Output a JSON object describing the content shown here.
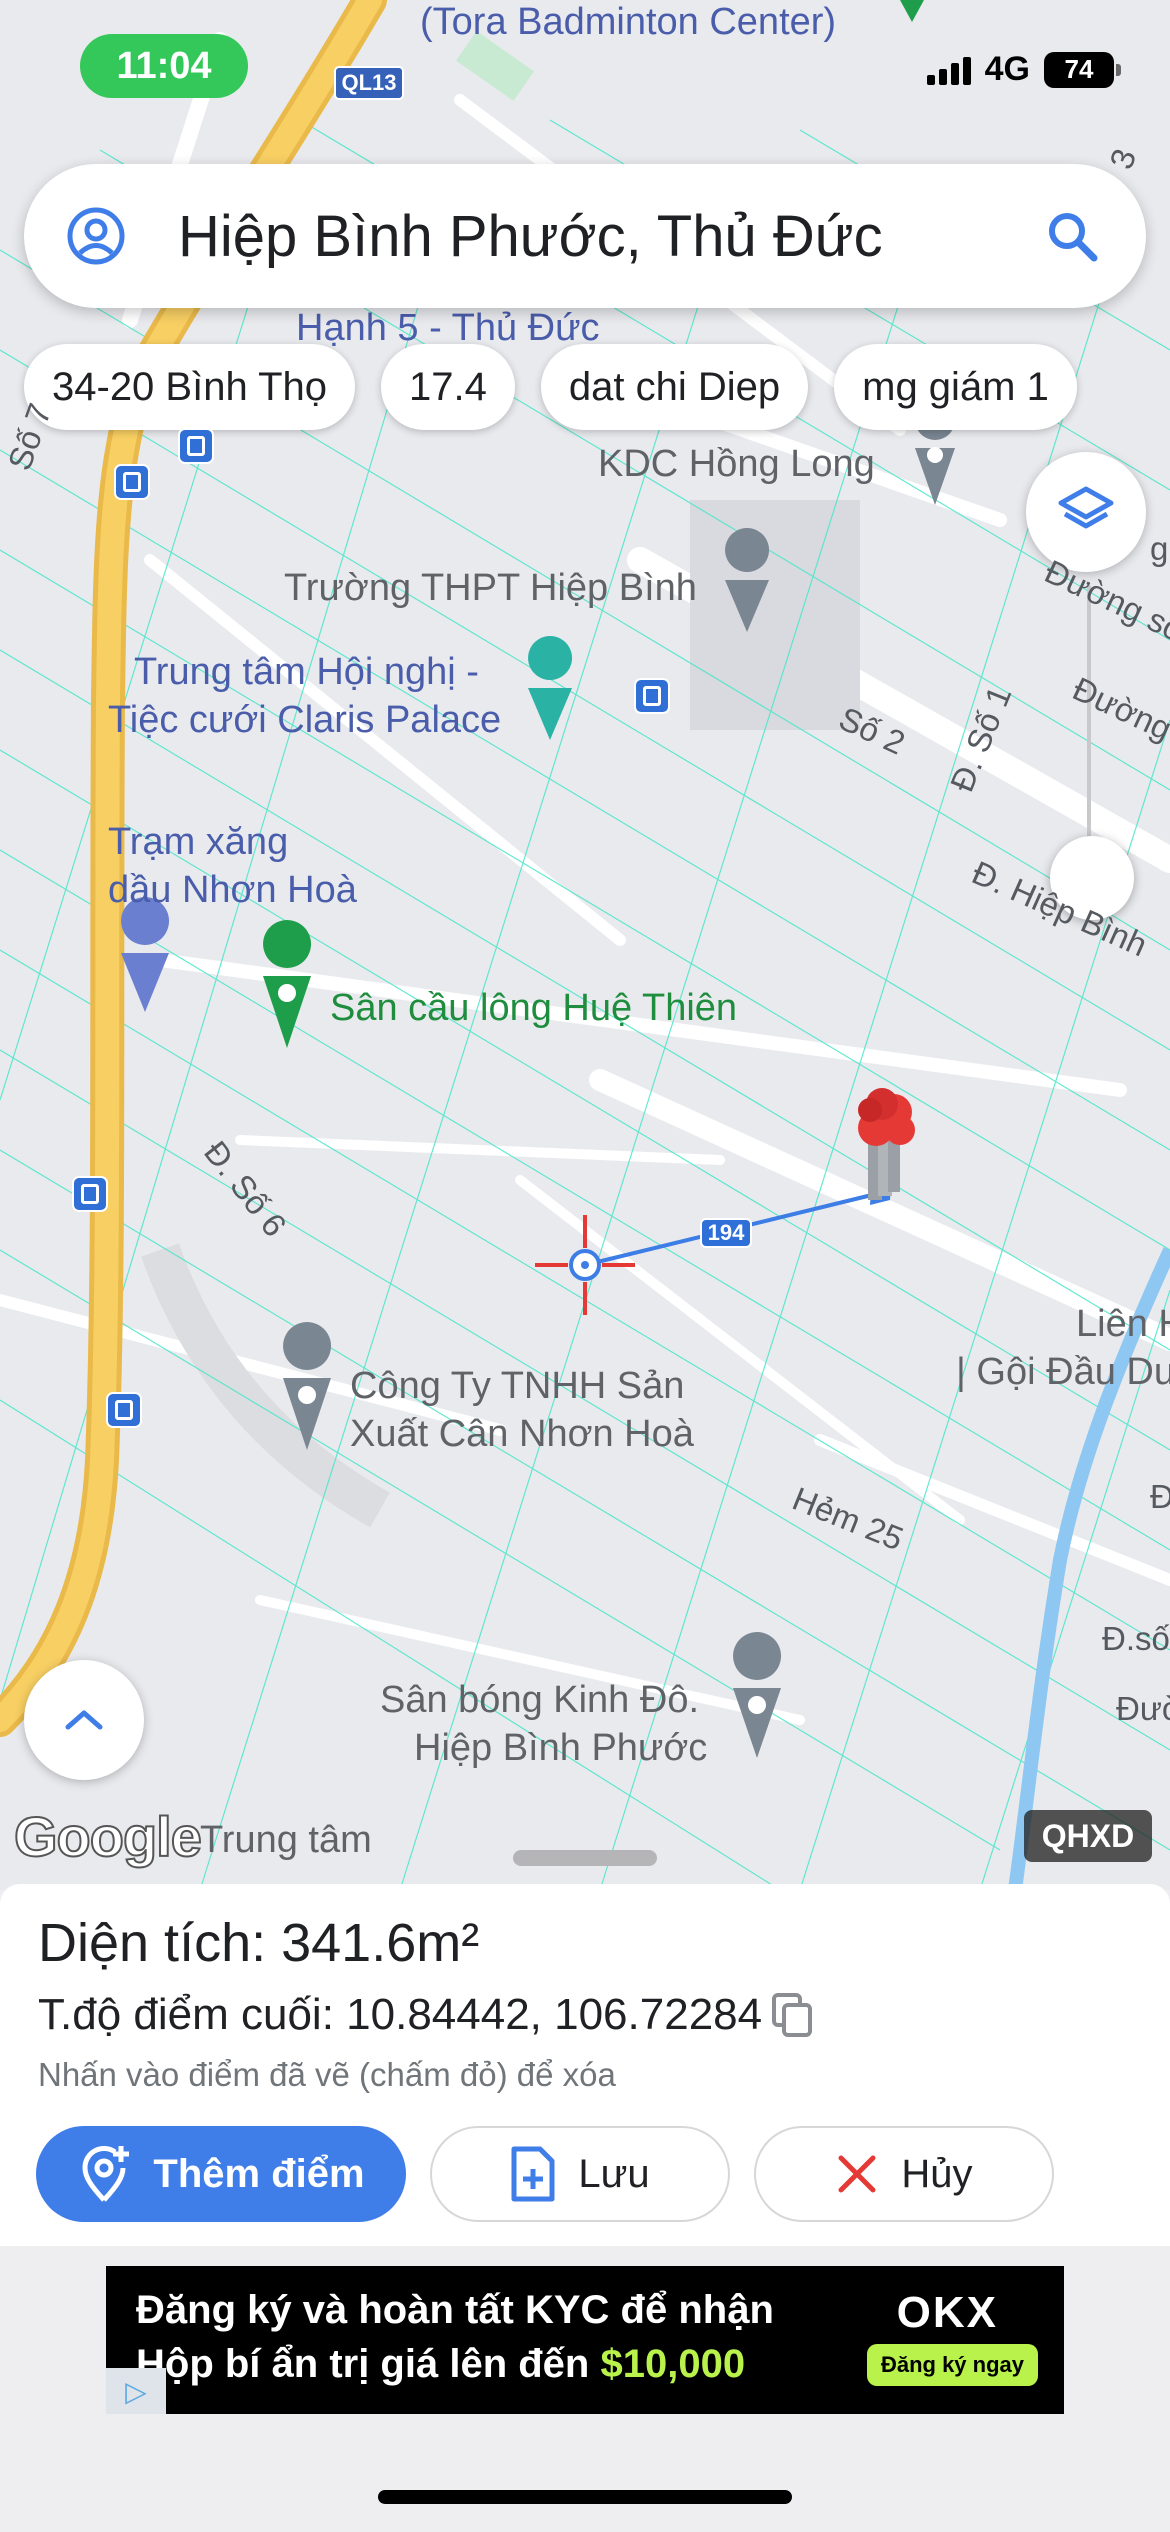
{
  "status_bar": {
    "time": "11:04",
    "network": "4G",
    "battery": "74"
  },
  "search": {
    "query": "Hiệp Bình Phước, Thủ Đức"
  },
  "chips": [
    "34-20 Bình Thọ",
    "17.4",
    "dat chi Diep",
    "mg giám 1"
  ],
  "map": {
    "places": {
      "top_center": "(Tora Badminton Center)",
      "top_partial": "Hạnh 5 - Thủ Đức",
      "kdc": "KDC Hồng Long",
      "school": "Trường THPT Hiệp Bình",
      "convention_1": "Trung tâm Hội nghị -",
      "convention_2": "Tiệc cưới Claris Palace",
      "gas_1": "Trạm xăng",
      "gas_2": "dầu Nhơn Hoà",
      "badminton": "Sân cầu lông Huệ Thiên",
      "company_1": "Công Ty TNHH Sản",
      "company_2": "Xuất Cân Nhơn Hoà",
      "stadium_1": "Sân bóng Kinh Đô.",
      "stadium_2": "Hiệp Bình Phước",
      "center_partial": "Trung tâm",
      "lien_partial": "Liên H",
      "goi_partial": "| Gội Đầu Du"
    },
    "streets": {
      "so2": "Số 2",
      "dso1": "Đ. Số 1",
      "hiep_binh": "Đ. Hiệp Bình",
      "duong_so": "Đường số",
      "duong": "Đường",
      "dso6": "Đ. Số 6",
      "hem25": "Hẻm 25",
      "so7": "Số 7",
      "dso_right": "Đ.số",
      "duong_right": "Đườ",
      "d_right": "Đ",
      "num3": "3",
      "g_right": "g"
    },
    "route_badge": "194",
    "highway_badge": "QL13",
    "attribution": "Google",
    "overlay_badge": "QHXD"
  },
  "panel": {
    "area": "Diện tích: 341.6m²",
    "coords": "T.độ điểm cuối: 10.84442, 106.72284",
    "hint": "Nhấn vào điểm đã vẽ (chấm đỏ) để xóa"
  },
  "buttons": {
    "add": "Thêm điểm",
    "save": "Lưu",
    "cancel": "Hủy"
  },
  "ad": {
    "line1": "Đăng ký và hoàn tất KYC để nhận",
    "line2_prefix": "Hộp bí ẩn trị giá lên đến ",
    "line2_amount": "$10,000",
    "brand": "OKX",
    "cta": "Đăng ký ngay"
  },
  "colors": {
    "accent": "#3f7de8",
    "highway": "#f6c552",
    "cad_lines": "#49e6c8",
    "pin_red": "#e53935",
    "place_green": "#1e8e3e"
  }
}
